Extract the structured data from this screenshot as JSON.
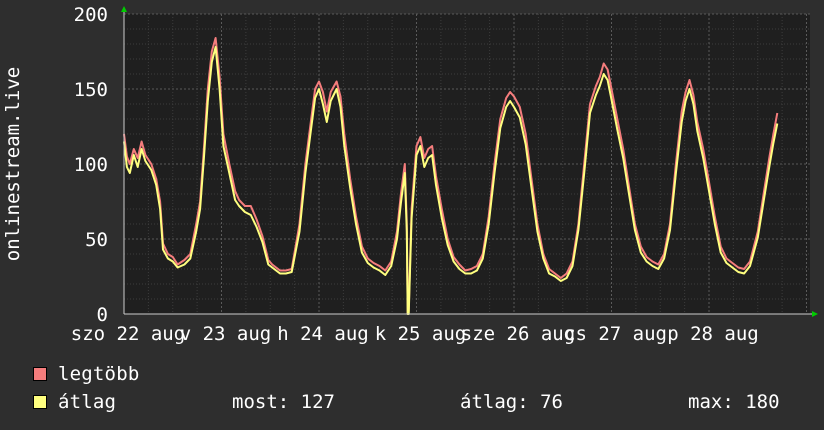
{
  "chart_data": {
    "type": "line",
    "ylabel": "onlinestream.live",
    "ylim": [
      0,
      200
    ],
    "yticks": [
      0,
      50,
      100,
      150,
      200
    ],
    "grid": true,
    "xticks": [
      "szo 22 aug",
      "v 23 aug",
      "h 24 aug",
      "k 25 aug",
      "sze 26 aug",
      "cs 27 aug",
      "p 28 aug"
    ],
    "x_range_days": [
      0,
      7
    ],
    "series": [
      {
        "name": "legtöbb",
        "color": "#f57d7d",
        "points": [
          [
            0.0,
            120
          ],
          [
            0.03,
            105
          ],
          [
            0.06,
            100
          ],
          [
            0.1,
            110
          ],
          [
            0.14,
            104
          ],
          [
            0.18,
            115
          ],
          [
            0.22,
            106
          ],
          [
            0.28,
            100
          ],
          [
            0.33,
            90
          ],
          [
            0.37,
            75
          ],
          [
            0.4,
            47
          ],
          [
            0.45,
            40
          ],
          [
            0.5,
            38
          ],
          [
            0.55,
            33
          ],
          [
            0.62,
            36
          ],
          [
            0.68,
            40
          ],
          [
            0.74,
            60
          ],
          [
            0.78,
            75
          ],
          [
            0.82,
            110
          ],
          [
            0.86,
            150
          ],
          [
            0.9,
            175
          ],
          [
            0.94,
            184
          ],
          [
            0.98,
            158
          ],
          [
            1.02,
            120
          ],
          [
            1.08,
            100
          ],
          [
            1.14,
            82
          ],
          [
            1.18,
            76
          ],
          [
            1.24,
            72
          ],
          [
            1.3,
            72
          ],
          [
            1.36,
            63
          ],
          [
            1.42,
            52
          ],
          [
            1.48,
            36
          ],
          [
            1.52,
            33
          ],
          [
            1.56,
            31
          ],
          [
            1.6,
            29
          ],
          [
            1.66,
            29
          ],
          [
            1.72,
            30
          ],
          [
            1.8,
            60
          ],
          [
            1.86,
            100
          ],
          [
            1.92,
            130
          ],
          [
            1.96,
            150
          ],
          [
            2.0,
            155
          ],
          [
            2.04,
            148
          ],
          [
            2.08,
            135
          ],
          [
            2.12,
            148
          ],
          [
            2.18,
            155
          ],
          [
            2.22,
            145
          ],
          [
            2.26,
            120
          ],
          [
            2.32,
            90
          ],
          [
            2.38,
            65
          ],
          [
            2.44,
            45
          ],
          [
            2.5,
            37
          ],
          [
            2.56,
            34
          ],
          [
            2.62,
            32
          ],
          [
            2.68,
            29
          ],
          [
            2.74,
            35
          ],
          [
            2.8,
            55
          ],
          [
            2.84,
            80
          ],
          [
            2.88,
            100
          ],
          [
            2.9,
            60
          ],
          [
            2.91,
            0
          ],
          [
            2.92,
            2
          ],
          [
            2.95,
            70
          ],
          [
            3.0,
            112
          ],
          [
            3.04,
            118
          ],
          [
            3.08,
            104
          ],
          [
            3.12,
            110
          ],
          [
            3.16,
            112
          ],
          [
            3.2,
            92
          ],
          [
            3.26,
            70
          ],
          [
            3.32,
            50
          ],
          [
            3.38,
            38
          ],
          [
            3.44,
            33
          ],
          [
            3.5,
            29
          ],
          [
            3.56,
            30
          ],
          [
            3.62,
            32
          ],
          [
            3.68,
            40
          ],
          [
            3.74,
            65
          ],
          [
            3.8,
            100
          ],
          [
            3.86,
            130
          ],
          [
            3.92,
            144
          ],
          [
            3.96,
            148
          ],
          [
            4.0,
            145
          ],
          [
            4.06,
            138
          ],
          [
            4.12,
            120
          ],
          [
            4.18,
            90
          ],
          [
            4.24,
            60
          ],
          [
            4.3,
            40
          ],
          [
            4.36,
            30
          ],
          [
            4.42,
            27
          ],
          [
            4.48,
            24
          ],
          [
            4.54,
            27
          ],
          [
            4.6,
            35
          ],
          [
            4.66,
            60
          ],
          [
            4.72,
            100
          ],
          [
            4.78,
            140
          ],
          [
            4.84,
            152
          ],
          [
            4.88,
            158
          ],
          [
            4.92,
            167
          ],
          [
            4.96,
            163
          ],
          [
            5.0,
            150
          ],
          [
            5.06,
            130
          ],
          [
            5.12,
            110
          ],
          [
            5.18,
            85
          ],
          [
            5.24,
            60
          ],
          [
            5.3,
            45
          ],
          [
            5.36,
            38
          ],
          [
            5.42,
            35
          ],
          [
            5.48,
            33
          ],
          [
            5.54,
            40
          ],
          [
            5.6,
            60
          ],
          [
            5.66,
            100
          ],
          [
            5.72,
            135
          ],
          [
            5.76,
            148
          ],
          [
            5.8,
            156
          ],
          [
            5.84,
            146
          ],
          [
            5.88,
            128
          ],
          [
            5.94,
            110
          ],
          [
            6.0,
            88
          ],
          [
            6.06,
            65
          ],
          [
            6.12,
            45
          ],
          [
            6.18,
            37
          ],
          [
            6.24,
            34
          ],
          [
            6.3,
            31
          ],
          [
            6.36,
            30
          ],
          [
            6.42,
            35
          ],
          [
            6.5,
            55
          ],
          [
            6.56,
            80
          ],
          [
            6.62,
            105
          ],
          [
            6.66,
            120
          ],
          [
            6.7,
            134
          ]
        ]
      },
      {
        "name": "átlag",
        "color": "#ffff7f",
        "points": [
          [
            0.0,
            115
          ],
          [
            0.03,
            98
          ],
          [
            0.06,
            94
          ],
          [
            0.1,
            106
          ],
          [
            0.14,
            98
          ],
          [
            0.18,
            110
          ],
          [
            0.22,
            102
          ],
          [
            0.28,
            96
          ],
          [
            0.33,
            86
          ],
          [
            0.37,
            70
          ],
          [
            0.4,
            43
          ],
          [
            0.45,
            37
          ],
          [
            0.5,
            35
          ],
          [
            0.55,
            31
          ],
          [
            0.62,
            33
          ],
          [
            0.68,
            37
          ],
          [
            0.74,
            55
          ],
          [
            0.78,
            70
          ],
          [
            0.82,
            104
          ],
          [
            0.86,
            142
          ],
          [
            0.9,
            168
          ],
          [
            0.94,
            178
          ],
          [
            0.98,
            150
          ],
          [
            1.02,
            112
          ],
          [
            1.08,
            94
          ],
          [
            1.14,
            76
          ],
          [
            1.18,
            72
          ],
          [
            1.24,
            68
          ],
          [
            1.3,
            66
          ],
          [
            1.36,
            58
          ],
          [
            1.42,
            48
          ],
          [
            1.48,
            33
          ],
          [
            1.52,
            31
          ],
          [
            1.56,
            29
          ],
          [
            1.6,
            27
          ],
          [
            1.66,
            27
          ],
          [
            1.72,
            28
          ],
          [
            1.8,
            55
          ],
          [
            1.86,
            94
          ],
          [
            1.92,
            124
          ],
          [
            1.96,
            144
          ],
          [
            2.0,
            150
          ],
          [
            2.04,
            140
          ],
          [
            2.08,
            128
          ],
          [
            2.12,
            142
          ],
          [
            2.18,
            150
          ],
          [
            2.22,
            138
          ],
          [
            2.26,
            112
          ],
          [
            2.32,
            84
          ],
          [
            2.38,
            60
          ],
          [
            2.44,
            41
          ],
          [
            2.5,
            34
          ],
          [
            2.56,
            31
          ],
          [
            2.62,
            29
          ],
          [
            2.68,
            26
          ],
          [
            2.74,
            32
          ],
          [
            2.8,
            50
          ],
          [
            2.84,
            74
          ],
          [
            2.88,
            94
          ],
          [
            2.9,
            55
          ],
          [
            2.91,
            0
          ],
          [
            2.92,
            0
          ],
          [
            2.95,
            64
          ],
          [
            3.0,
            106
          ],
          [
            3.04,
            112
          ],
          [
            3.08,
            98
          ],
          [
            3.12,
            104
          ],
          [
            3.16,
            106
          ],
          [
            3.2,
            86
          ],
          [
            3.26,
            64
          ],
          [
            3.32,
            46
          ],
          [
            3.38,
            35
          ],
          [
            3.44,
            30
          ],
          [
            3.5,
            27
          ],
          [
            3.56,
            27
          ],
          [
            3.62,
            29
          ],
          [
            3.68,
            37
          ],
          [
            3.74,
            60
          ],
          [
            3.8,
            94
          ],
          [
            3.86,
            124
          ],
          [
            3.92,
            138
          ],
          [
            3.96,
            142
          ],
          [
            4.0,
            138
          ],
          [
            4.06,
            131
          ],
          [
            4.12,
            113
          ],
          [
            4.18,
            84
          ],
          [
            4.24,
            55
          ],
          [
            4.3,
            37
          ],
          [
            4.36,
            27
          ],
          [
            4.42,
            25
          ],
          [
            4.48,
            22
          ],
          [
            4.54,
            24
          ],
          [
            4.6,
            32
          ],
          [
            4.66,
            56
          ],
          [
            4.72,
            94
          ],
          [
            4.78,
            134
          ],
          [
            4.84,
            146
          ],
          [
            4.88,
            152
          ],
          [
            4.92,
            160
          ],
          [
            4.96,
            156
          ],
          [
            5.0,
            143
          ],
          [
            5.06,
            123
          ],
          [
            5.12,
            104
          ],
          [
            5.18,
            80
          ],
          [
            5.24,
            56
          ],
          [
            5.3,
            41
          ],
          [
            5.36,
            35
          ],
          [
            5.42,
            32
          ],
          [
            5.48,
            30
          ],
          [
            5.54,
            37
          ],
          [
            5.6,
            56
          ],
          [
            5.66,
            94
          ],
          [
            5.72,
            128
          ],
          [
            5.76,
            142
          ],
          [
            5.8,
            150
          ],
          [
            5.84,
            140
          ],
          [
            5.88,
            122
          ],
          [
            5.94,
            104
          ],
          [
            6.0,
            82
          ],
          [
            6.06,
            60
          ],
          [
            6.12,
            41
          ],
          [
            6.18,
            34
          ],
          [
            6.24,
            31
          ],
          [
            6.3,
            28
          ],
          [
            6.36,
            27
          ],
          [
            6.42,
            32
          ],
          [
            6.5,
            51
          ],
          [
            6.56,
            75
          ],
          [
            6.62,
            99
          ],
          [
            6.66,
            114
          ],
          [
            6.7,
            127
          ]
        ]
      }
    ]
  },
  "legend": {
    "items": [
      {
        "label": "legtöbb",
        "color": "#f57d7d"
      },
      {
        "label": "átlag",
        "color": "#ffff7f"
      }
    ]
  },
  "stats": {
    "now": "most: 127",
    "avg": "átlag: 76",
    "max": "max: 180"
  },
  "colors": {
    "background": "#2e2e2e",
    "plot_background": "#1f1f1f",
    "grid_major": "#5a5a5a",
    "grid_minor": "#3c3c3c",
    "axis_arrow": "#00cc00"
  }
}
